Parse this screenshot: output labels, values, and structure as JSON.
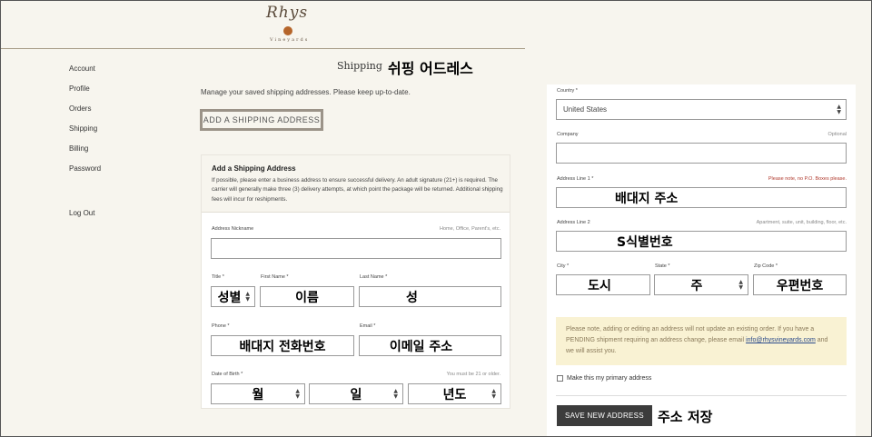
{
  "brand": {
    "name": "Rhys",
    "sub": "Vineyards"
  },
  "nav": {
    "items": [
      "Account",
      "Profile",
      "Orders",
      "Shipping",
      "Billing",
      "Password"
    ],
    "logout": "Log Out"
  },
  "page": {
    "title": "Shipping",
    "title_ko": "쉬핑 어드레스",
    "intro": "Manage your saved shipping addresses. Please keep up-to-date.",
    "add_button": "ADD A SHIPPING ADDRESS"
  },
  "form": {
    "title": "Add a Shipping Address",
    "description": "If possible, please enter a business address to ensure successful delivery. An adult signature (21+) is required. The carrier will generally make three (3) delivery attempts, at which point the package will be returned. Additional shipping fees will incur for reshipments.",
    "nickname": {
      "label": "Address Nickname",
      "hint": "Home, Office, Parent's, etc.",
      "value": ""
    },
    "title_field": {
      "label": "Title *",
      "value": "성별"
    },
    "first_name": {
      "label": "First Name *",
      "value": "이름"
    },
    "last_name": {
      "label": "Last Name *",
      "value": "성"
    },
    "phone": {
      "label": "Phone *",
      "value": "배대지 전화번호"
    },
    "email": {
      "label": "Email *",
      "value": "이메일 주소"
    },
    "dob": {
      "label": "Date of Birth *",
      "hint": "You must be 21 or older.",
      "month": "월",
      "day": "일",
      "year": "년도"
    }
  },
  "address": {
    "country": {
      "label": "Country *",
      "value": "United States"
    },
    "company": {
      "label": "Company",
      "hint": "Optional",
      "value": ""
    },
    "line1": {
      "label": "Address Line 1 *",
      "hint": "Please note, no P.O. Boxes please.",
      "value": "배대지 주소"
    },
    "line2": {
      "label": "Address Line 2",
      "hint": "Apartment, suite, unit, building, floor, etc.",
      "value": "S식별번호"
    },
    "city": {
      "label": "City *",
      "value": "도시"
    },
    "state": {
      "label": "State *",
      "value": "주"
    },
    "zip": {
      "label": "Zip Code *",
      "value": "우편번호"
    },
    "notice_pre": "Please note, adding or editing an address will not update an existing order. If you have a PENDING shipment requiring an address change, please email ",
    "notice_email": "info@rhysvineyards.com",
    "notice_post": " and we will assist you.",
    "primary_label": "Make this my primary address",
    "save_button": "SAVE NEW ADDRESS",
    "save_ko": "주소 저장"
  }
}
